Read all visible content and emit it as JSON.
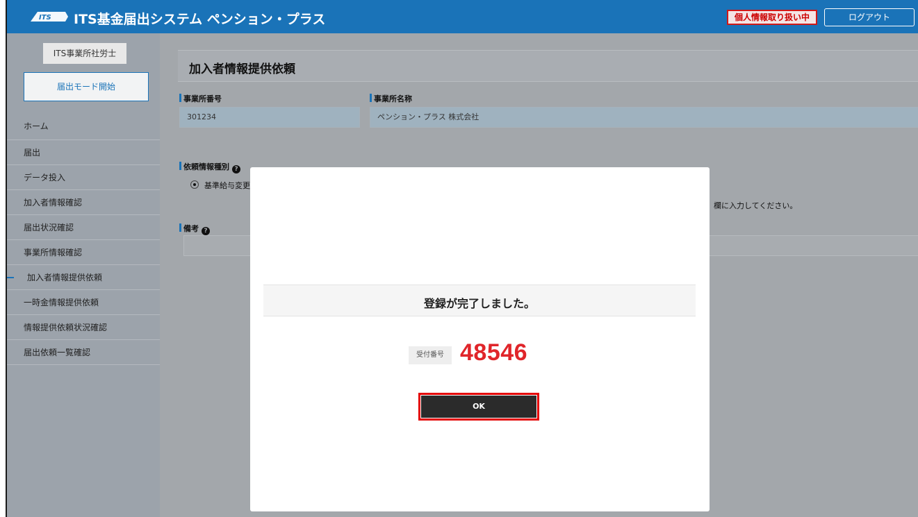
{
  "header": {
    "app_title": "ITS基金届出システム ペンション・プラス",
    "privacy_badge": "個人情報取り扱い中",
    "logout_label": "ログアウト",
    "color": "#1a73b8"
  },
  "sidebar": {
    "office_name": "ITS事業所社労士",
    "start_mode_label": "届出モード開始",
    "items": [
      {
        "label": "ホーム"
      },
      {
        "label": "届出"
      },
      {
        "label": "データ投入"
      },
      {
        "label": "加入者情報確認"
      },
      {
        "label": "届出状況確認"
      },
      {
        "label": "事業所情報確認"
      },
      {
        "label": "加入者情報提供依頼",
        "active": true
      },
      {
        "label": "一時金情報提供依頼"
      },
      {
        "label": "情報提供依頼状況確認"
      },
      {
        "label": "届出依頼一覧確認"
      }
    ]
  },
  "main": {
    "page_title": "加入者情報提供依頼",
    "office_number_label": "事業所番号",
    "office_number_value": "301234",
    "office_name_label": "事業所名称",
    "office_name_value": "ペンション・プラス 株式会社",
    "request_type_label": "依頼情報種別",
    "request_type_option": "基準給与変更",
    "hint_text": "欄に入力してください。",
    "note_label": "備考"
  },
  "modal": {
    "message": "登録が完了しました。",
    "receipt_label": "受付番号",
    "receipt_number": "48546",
    "ok_label": "OK",
    "accent_color": "#e0252a"
  }
}
